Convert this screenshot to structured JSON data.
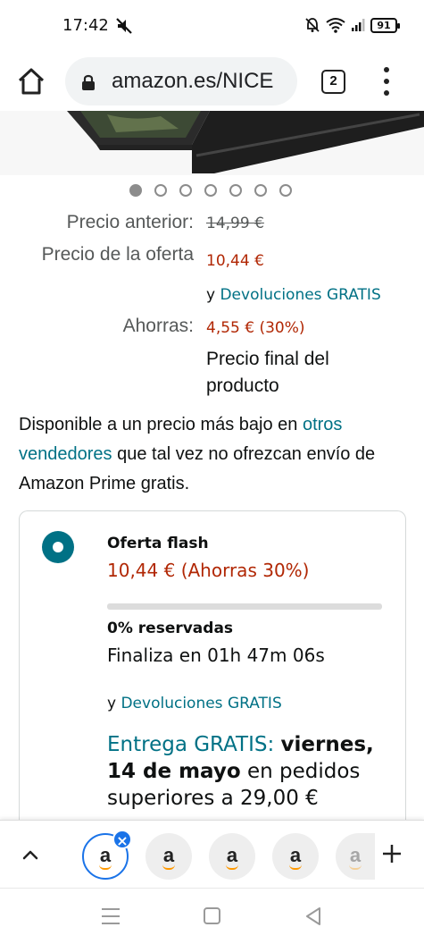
{
  "status_bar": {
    "time": "17:42",
    "battery": "91",
    "icons": [
      "mute-icon",
      "alarm-off-icon",
      "wifi-icon",
      "signal-icon",
      "battery-icon"
    ]
  },
  "browser": {
    "url": "amazon.es/NICE",
    "tab_count": "2",
    "icons": [
      "home-icon",
      "lock-icon",
      "tabs-icon",
      "overflow-menu-icon"
    ]
  },
  "carousel": {
    "total": 7,
    "active_index": 0
  },
  "pricing": {
    "previous_label": "Precio anterior:",
    "previous_value": "14,99 €",
    "offer_label": "Precio de la oferta",
    "offer_value": "10,44 €",
    "returns_prefix": "y",
    "returns_link": "Devoluciones GRATIS",
    "savings_label": "Ahorras:",
    "savings_value": "4,55 € (30%)",
    "final_text": "Precio final del producto"
  },
  "availability": {
    "text_before": "Disponible a un precio más bajo en ",
    "link": "otros vendedores",
    "text_after": " que tal vez no ofrezcan envío de Amazon Prime gratis."
  },
  "offer_card": {
    "title": "Oferta flash",
    "price": "10,44 € (Ahorras 30%)",
    "reserved_percent": 0,
    "reserved_text": "0% reservadas",
    "ends_text": "Finaliza en 01h 47m 06s",
    "returns_prefix": "y",
    "returns_link": "Devoluciones GRATIS",
    "delivery_link": "Entrega GRATIS:",
    "delivery_date": "viernes, 14 de mayo",
    "delivery_rest": " en pedidos superiores a 29,00 €"
  },
  "tab_strip": {
    "tab_letter": "a",
    "close_symbol": "×",
    "icons": [
      "chevron-up-icon",
      "amazon-icon",
      "close-icon",
      "add-icon"
    ]
  },
  "colors": {
    "price_red": "#b12704",
    "link_teal": "#007185",
    "accent_blue": "#1a73e8",
    "amazon_orange": "#ff9900"
  }
}
